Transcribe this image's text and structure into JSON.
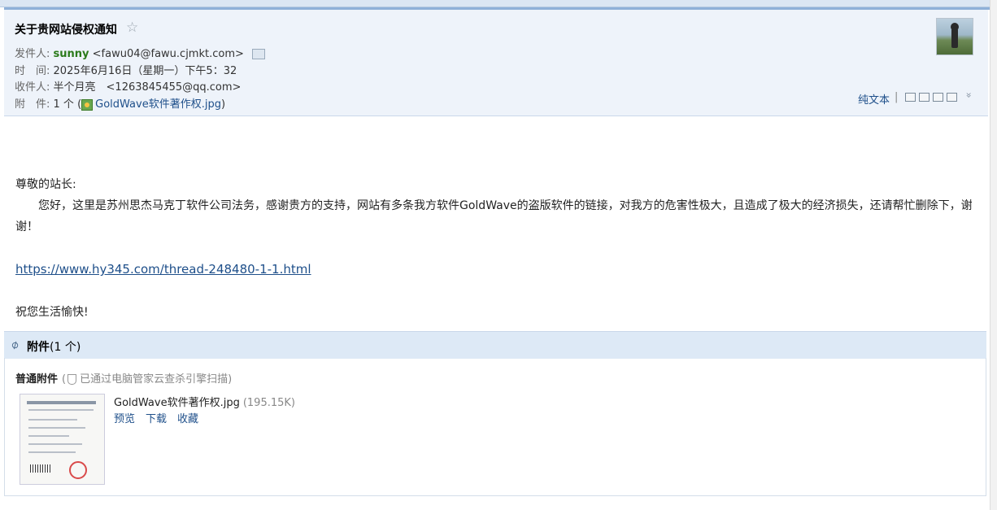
{
  "mail": {
    "subject": "关于贵网站侵权通知",
    "star_icon": "star-outline-icon",
    "from_label": "发件人:",
    "from_name": "sunny",
    "from_addr": "<fawu04@fawu.cjmkt.com>",
    "time_label": "时　间:",
    "time_value": "2025年6月16日（星期一）下午5：32",
    "to_label": "收件人:",
    "to_value": "半个月亮　<1263845455@qq.com>",
    "attach_label": "附　件:",
    "attach_count": "1 个 (",
    "attach_name": "GoldWave软件著作权.jpg",
    "attach_close": ")"
  },
  "toolbar": {
    "plain_text": "纯文本",
    "separator": "|"
  },
  "body": {
    "greeting": "尊敬的站长:",
    "paragraph": "您好，这里是苏州思杰马克丁软件公司法务，感谢贵方的支持，网站有多条我方软件GoldWave的盗版软件的链接，对我方的危害性极大，且造成了极大的经济损失，还请帮忙删除下，谢谢！",
    "link": "https://www.hy345.com/thread-248480-1-1.html",
    "closing": "祝您生活愉快!"
  },
  "attachments": {
    "header_bold": "附件",
    "header_count": "(1 个)",
    "normal_label": "普通附件",
    "scan_note_open": "(",
    "scan_note": "已通过电脑管家云查杀引擎扫描)",
    "file_name": "GoldWave软件著作权.jpg",
    "file_size": "(195.15K)",
    "actions": [
      "预览",
      "下载",
      "收藏"
    ]
  },
  "colors": {
    "header_bg": "#eef3fa",
    "link": "#1e4f8a",
    "sender_name": "#2a7a1a",
    "attach_bar": "#dde9f6"
  }
}
